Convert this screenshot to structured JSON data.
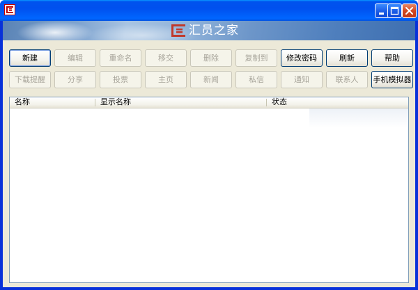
{
  "window": {
    "title": "",
    "icon": "app-logo-icon",
    "controls": {
      "minimize_icon": "minimize-icon",
      "maximize_icon": "maximize-icon",
      "close_icon": "close-icon"
    }
  },
  "banner": {
    "logo_text": "汇员之家",
    "logo_icon": "hy-logo-mark",
    "accent_color": "#c0392b"
  },
  "toolbar": {
    "row1": [
      {
        "label": "新建",
        "enabled": true
      },
      {
        "label": "编辑",
        "enabled": false
      },
      {
        "label": "重命名",
        "enabled": false
      },
      {
        "label": "移交",
        "enabled": false
      },
      {
        "label": "删除",
        "enabled": false
      },
      {
        "label": "复制到",
        "enabled": false
      },
      {
        "label": "修改密码",
        "enabled": true
      },
      {
        "label": "刷新",
        "enabled": true
      },
      {
        "label": "帮助",
        "enabled": true
      }
    ],
    "row2": [
      {
        "label": "下载提醒",
        "enabled": false
      },
      {
        "label": "分享",
        "enabled": false
      },
      {
        "label": "投票",
        "enabled": false
      },
      {
        "label": "主页",
        "enabled": false
      },
      {
        "label": "新闻",
        "enabled": false
      },
      {
        "label": "私信",
        "enabled": false
      },
      {
        "label": "通知",
        "enabled": false
      },
      {
        "label": "联系人",
        "enabled": false
      },
      {
        "label": "手机模拟器",
        "enabled": true
      }
    ]
  },
  "list": {
    "columns": [
      "名称",
      "显示名称",
      "状态"
    ],
    "rows": []
  }
}
